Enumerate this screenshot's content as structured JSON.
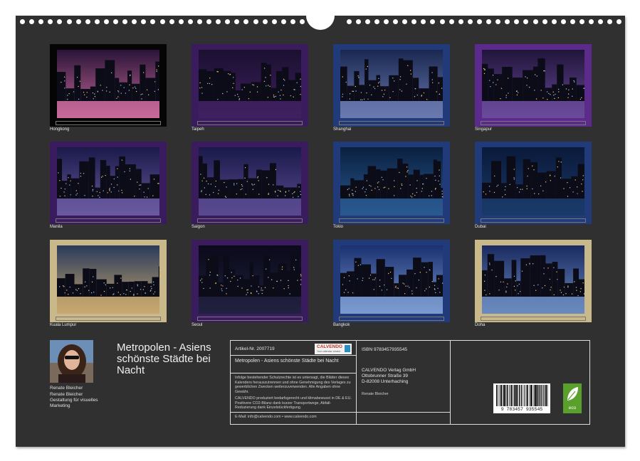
{
  "thumbnails": [
    {
      "caption": "Hongkong",
      "theme": "fog"
    },
    {
      "caption": "Taipeh",
      "theme": "traffic"
    },
    {
      "caption": "Shanghai",
      "theme": "river"
    },
    {
      "caption": "Singapur",
      "theme": "bay"
    },
    {
      "caption": "Manila",
      "theme": "harbor"
    },
    {
      "caption": "Saigon",
      "theme": "towers"
    },
    {
      "caption": "Tokio",
      "theme": "sprawl"
    },
    {
      "caption": "Dubai",
      "theme": "reflection"
    },
    {
      "caption": "Kuala Lumpur",
      "theme": "twin"
    },
    {
      "caption": "Seoul",
      "theme": "fountain"
    },
    {
      "caption": "Bangkok",
      "theme": "dusk"
    },
    {
      "caption": "Doha",
      "theme": "promenade"
    }
  ],
  "author": {
    "name": "Renate Bleicher",
    "line2": "Renate Bleicher",
    "line3": "Gestaltung für visuelles",
    "line4": "Marketing"
  },
  "title": "Metropolen - Asiens schönste Städte bei Nacht",
  "info": {
    "article": "Artikel-Nr. 2007719",
    "logo_text": "CALVENDO",
    "logo_sub": "Your calendar creator",
    "product_title": "Metropolen - Asiens schönste Städte bei Nacht",
    "legal1": "Infolge bestehender Schutzrechte ist es untersagt, die Blätter dieses Kalenders herauszutrennen und ohne Genehmigung des Verlages zu gewerblichen Zwecken weiterzuverwenden. Alle Angaben ohne Gewähr.",
    "legal2": "CALVENDO produziert bedarfsgerecht und klimabewusst in DE & EU. Positivere CO2-Bilanz dank kurzer Transportwege, Abfall-Reduzierung dank Einzelstückfertigung.",
    "contact": "E-Mail: info@calvendo.com • www.calvendo.com",
    "isbn": "ISBN 9783457935545",
    "publisher1": "CALVENDO Verlag GmbH",
    "publisher2": "Ottobrunner Straße 39",
    "publisher3": "D-82008 Unterhaching",
    "author_credit": "Renate Bleicher",
    "barcode_number": "9 783457 935545",
    "eco_label": "eco"
  },
  "colors": {
    "background": "#303030",
    "purple_frame": "#5b2a8a",
    "blue_frame": "#213a7a",
    "gold_frame": "#c8b88a",
    "eco_green": "#5aa02c"
  }
}
